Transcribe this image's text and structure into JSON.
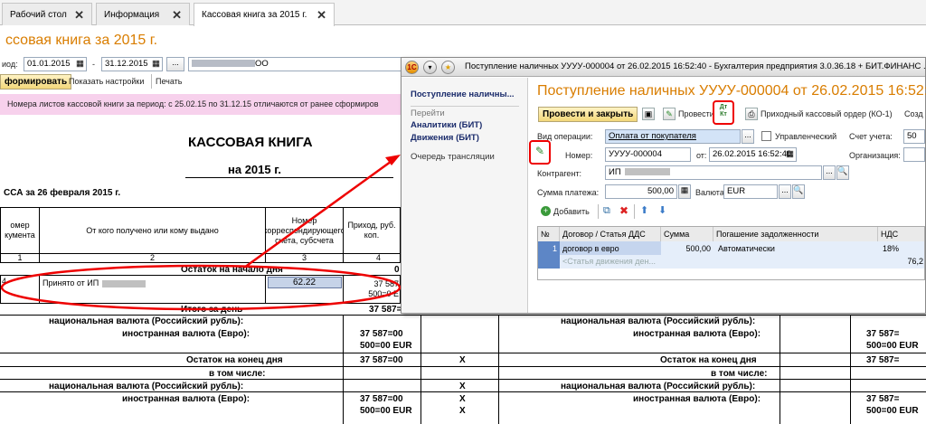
{
  "tabs": [
    {
      "label": "Рабочий стол",
      "close": "✕"
    },
    {
      "label": "Информация",
      "close": "✕"
    },
    {
      "label": "Кассовая книга за 2015 г.",
      "close": "✕"
    }
  ],
  "report": {
    "title": "ссовая книга за 2015 г.",
    "period_label": "иод:",
    "date_from": "01.01.2015",
    "dash": "-",
    "date_to": "31.12.2015",
    "dots": "...",
    "org": "ОО",
    "form_btn": "формировать",
    "show_settings": "Показать настройки",
    "print": "Печать",
    "notice": "Номера листов кассовой книги за период: с 25.02.15 по 31.12.15 отличаются от ранее сформиров",
    "book_title": "КАССОВАЯ КНИГА",
    "year": "на 2015 г.",
    "cash_date": "ССА за 26 февраля 2015 г."
  },
  "table": {
    "h_num": "омер кумента",
    "h_from": "От кого получено или кому выдано",
    "h_corr": "Номер корреспондирующего счета, субсчета",
    "h_income": "Приход, руб. коп.",
    "n1": "1",
    "n2": "2",
    "n3": "3",
    "n4": "4",
    "opening": "Остаток на начало дня",
    "opening_val": "0",
    "row_num": "4",
    "row_from": "Принято от ИП",
    "row_corr": "62.22",
    "row_inc1": "37 587",
    "row_inc2": "500=0 E",
    "total_day": "Итого за день",
    "total_val": "37 587=00",
    "nat_cur": "национальная валюта (Российский рубль):",
    "foreign_cur": "иностранная валюта (Евро):",
    "fc_val1": "37 587=00",
    "fc_val2": "500=00 EUR",
    "closing": "Остаток на конец дня",
    "closing_val": "37 587=00",
    "incl": "в том числе:",
    "x": "X",
    "fc2_val1": "37 587=00",
    "fc2_val2": "500=00 EUR",
    "r_foreign": "иностранная валюта (Евро):",
    "r_nat": "национальная валюта (Российский рубль):",
    "r_closing": "Остаток на конец дня",
    "r_incl": "в том числе:",
    "r_val1": "37 587=",
    "r_val2": "500=00 EUR",
    "r_val3": "37 587=",
    "r_val4": "37 587=",
    "r_val5": "500=00 EUR",
    "r_top": "Итого за день"
  },
  "dialog": {
    "icon_label": "1С",
    "title": "Поступление наличных УУУУ-000004 от 26.02.2015 16:52:40 - Бухгалтерия предприятия 3.0.36.18 + БИТ.ФИНАНС ...",
    "nav_main": "Поступление наличны...",
    "nav_goto": "Перейти",
    "nav_analytics": "Аналитики (БИТ)",
    "nav_movements": "Движения (БИТ)",
    "nav_queue": "Очередь трансляции",
    "header": "Поступление наличных УУУУ-000004 от 26.02.2015 16:52:40",
    "btn_post_close": "Провести и закрыть",
    "btn_post": "Провести",
    "dtkt": "Дт Кт",
    "btn_ko": "Приходный кассовый ордер (КО-1)",
    "btn_more": "Созд",
    "op_label": "Вид операции:",
    "op_value": "Оплата от покупателя",
    "managerial": "Управленческий",
    "acct_label": "Счет учета:",
    "acct_value": "50",
    "num_label": "Номер:",
    "num_value": "УУУУ-000004",
    "from_label": "от:",
    "date_value": "26.02.2015 16:52:40",
    "org_label": "Организация:",
    "contr_label": "Контрагент:",
    "contr_value": "ИП",
    "sum_label": "Сумма платежа:",
    "sum_value": "500,00",
    "cur_label": "Валюта:",
    "cur_value": "EUR",
    "add_btn": "Добавить",
    "grid_headers": [
      "№",
      "Договор / Статья ДДС",
      "Сумма",
      "Погашение задолженности",
      "НДС"
    ],
    "row1": {
      "n": "1",
      "contract": "договор в евро",
      "sum": "500,00",
      "repay": "Автоматически",
      "vat": "18%"
    },
    "row2": {
      "article": "<Статья движения ден...",
      "vat": "76,2"
    }
  },
  "colors": {
    "accent": "#d97d00",
    "highlight": "#e00000",
    "nav": "#1a2b6b",
    "notice": "#f7d1ec"
  }
}
